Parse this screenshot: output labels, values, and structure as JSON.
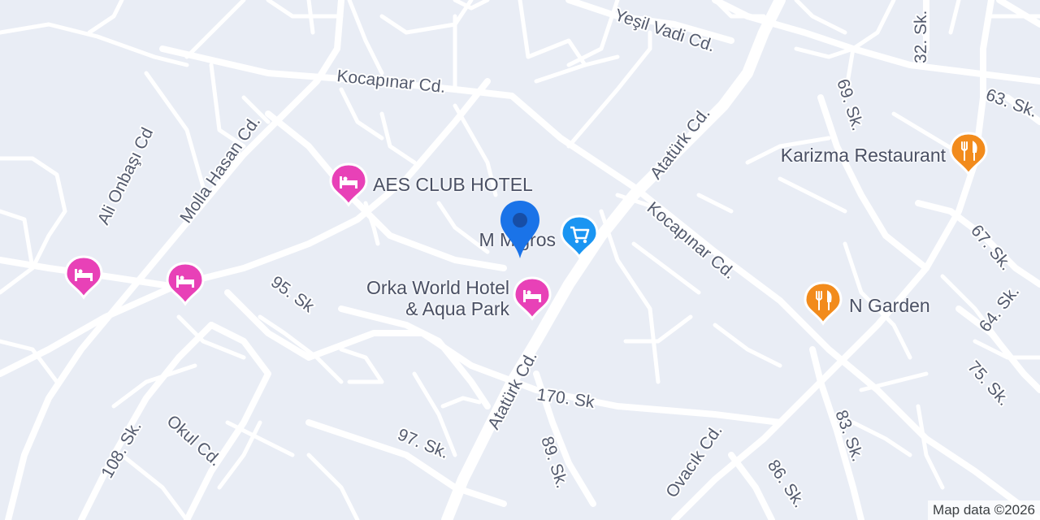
{
  "map": {
    "attribution": "Map data ©2026",
    "colors": {
      "background": "#e9edf5",
      "road": "#ffffff",
      "hotel": "#e841b7",
      "restaurant": "#f28b1c",
      "shopping": "#1a95f2",
      "location_pin": "#1a73e8"
    }
  },
  "streets": [
    "Kocapınar Cd.",
    "Yeşil Vadi Cd.",
    "32. Sk.",
    "69. Sk.",
    "63. Sk.",
    "Atatürk Cd.",
    "Atatürk Cd.",
    "Kocapınar Cd.",
    "67. Sk.",
    "64. Sk.",
    "75. Sk.",
    "Ali Onbaşı Cd",
    "Molla Hasan Cd.",
    "95. Sk",
    "170. Sk",
    "Okul Cd.",
    "108. Sk.",
    "97. Sk.",
    "89. Sk.",
    "Ovacık Cd.",
    "86. Sk.",
    "83. Sk."
  ],
  "pois": [
    {
      "name": "AES CLUB HOTEL",
      "category": "hotel",
      "icon": "hotel-bed-icon"
    },
    {
      "name": "Orka World Hotel\n& Aqua Park",
      "category": "hotel",
      "icon": "hotel-bed-icon"
    },
    {
      "name": "",
      "category": "hotel",
      "icon": "hotel-bed-icon"
    },
    {
      "name": "",
      "category": "hotel",
      "icon": "hotel-bed-icon"
    },
    {
      "name": "M Migros",
      "category": "shopping",
      "icon": "shopping-cart-icon"
    },
    {
      "name": "Karizma Restaurant",
      "category": "restaurant",
      "icon": "fork-knife-icon"
    },
    {
      "name": "N Garden",
      "category": "restaurant",
      "icon": "fork-knife-icon"
    }
  ],
  "location_marker": {
    "icon": "location-pin-icon"
  }
}
